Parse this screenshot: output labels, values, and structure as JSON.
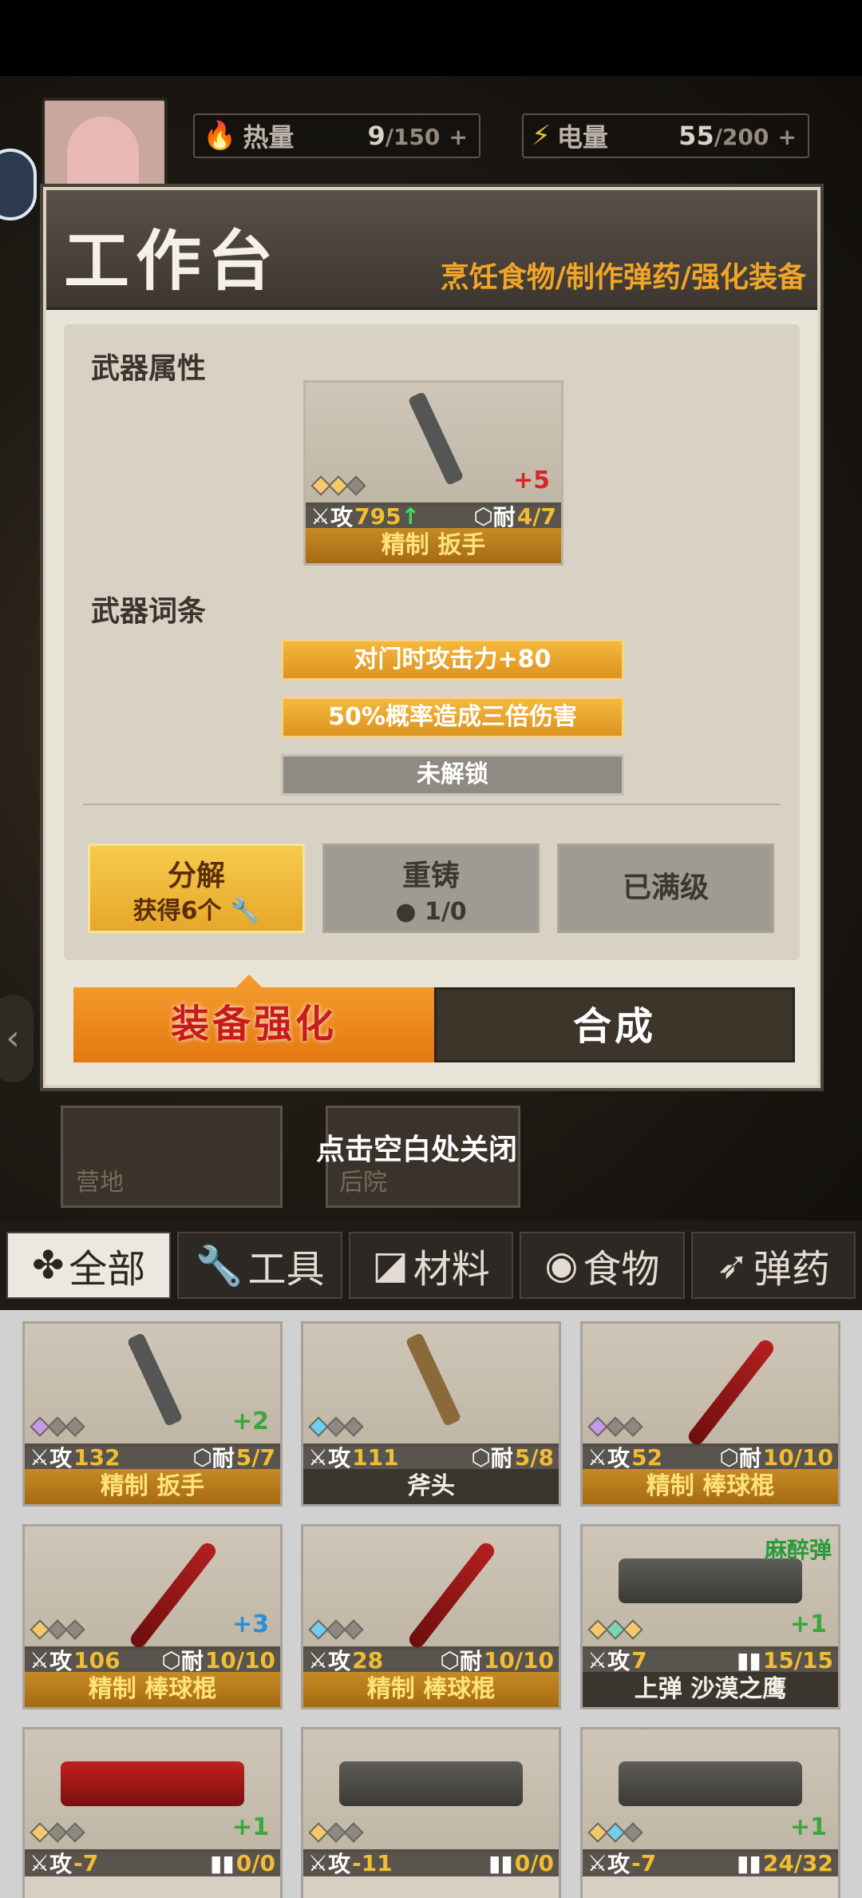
{
  "resources": [
    {
      "icon": "fire-icon",
      "label": "热量",
      "value": "9",
      "max": "/150",
      "plus": "+"
    },
    {
      "icon": "battery-icon",
      "label": "电量",
      "value": "55",
      "max": "/200",
      "plus": "+"
    }
  ],
  "modal": {
    "title": "工作台",
    "subtitle": "烹饪食物/制作弹药/强化装备",
    "section_attr": "武器属性",
    "section_affix": "武器词条",
    "weapon": {
      "atk_label": "攻",
      "atk": "795",
      "arrow": "↑",
      "dur_label": "耐",
      "dur": "4/7",
      "plus": "+5",
      "name": "精制 扳手"
    },
    "affixes": [
      "对门时攻击力+80",
      "50%概率造成三倍伤害",
      "未解锁"
    ],
    "buttons": {
      "decompose": "分解",
      "decompose_gain": "获得6个",
      "recast": "重铸",
      "recast_cost": "1/0",
      "maxed": "已满级"
    },
    "tabs": [
      "装备强化",
      "合成"
    ]
  },
  "background": {
    "camp": "营地",
    "backyard": "后院"
  },
  "close_hint": "点击空白处关闭",
  "categories": [
    "全部",
    "工具",
    "材料",
    "食物",
    "弹药"
  ],
  "items": [
    {
      "atk": "132",
      "dur": "5/7",
      "plus": "+2",
      "name": "精制 扳手"
    },
    {
      "atk": "111",
      "dur": "5/8",
      "plus": "",
      "name": "斧头"
    },
    {
      "atk": "52",
      "dur": "10/10",
      "plus": "",
      "name": "精制 棒球棍"
    },
    {
      "atk": "106",
      "dur": "10/10",
      "plus": "+3",
      "name": "精制 棒球棍"
    },
    {
      "atk": "28",
      "dur": "10/10",
      "plus": "",
      "name": "精制 棒球棍"
    },
    {
      "atk": "7",
      "dur": "15/15",
      "plus": "+1",
      "name": "上弹 沙漠之鹰",
      "tag": "麻醉弹"
    },
    {
      "atk": "-7",
      "dur": "0/0",
      "plus": "+1",
      "name": ""
    },
    {
      "atk": "-11",
      "dur": "0/0",
      "plus": "",
      "name": ""
    },
    {
      "atk": "-7",
      "dur": "24/32",
      "plus": "+1",
      "name": ""
    }
  ],
  "labels": {
    "atk": "攻",
    "dur": "耐"
  }
}
